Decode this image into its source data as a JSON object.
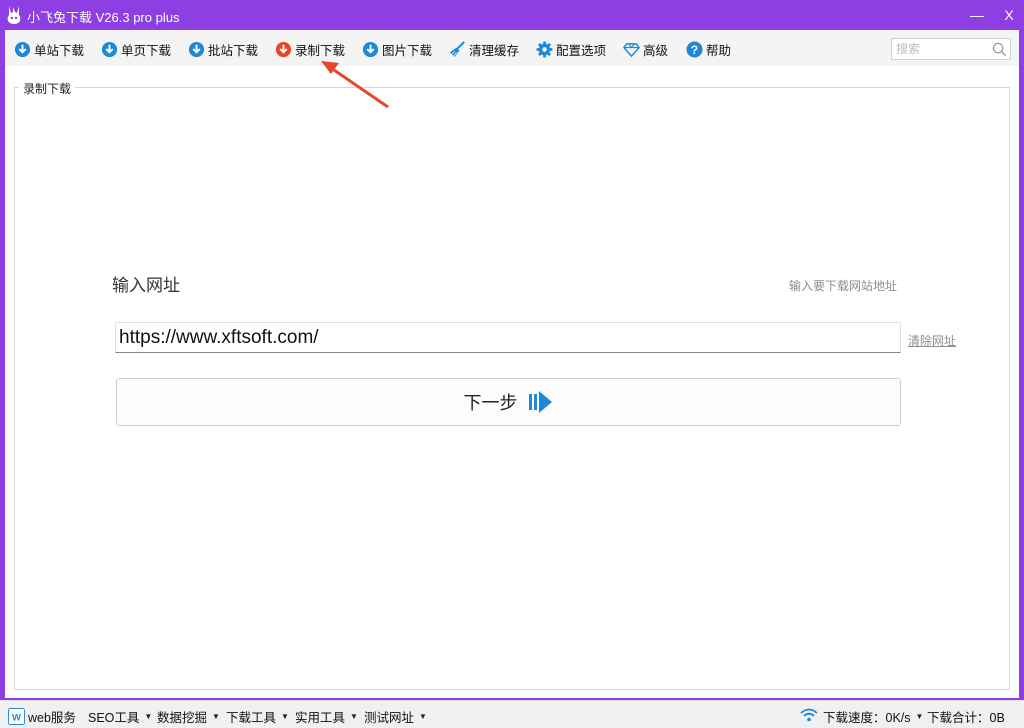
{
  "window": {
    "title": "小飞兔下载 V26.3 pro plus",
    "minimize_glyph": "—",
    "close_glyph": "X"
  },
  "toolbar": {
    "items": [
      {
        "label": "单站下载",
        "icon": "cloud-download-icon",
        "color": "#1e88d8"
      },
      {
        "label": "单页下载",
        "icon": "cloud-download-icon",
        "color": "#1e88d8"
      },
      {
        "label": "批站下载",
        "icon": "cloud-download-icon",
        "color": "#1e88d8"
      },
      {
        "label": "录制下载",
        "icon": "cloud-download-icon",
        "color": "#e8452c"
      },
      {
        "label": "图片下载",
        "icon": "cloud-download-icon",
        "color": "#1e88d8"
      },
      {
        "label": "清理缓存",
        "icon": "broom-icon",
        "color": "#1e88d8"
      },
      {
        "label": "配置选项",
        "icon": "gear-icon",
        "color": "#1e88d8"
      },
      {
        "label": "高级",
        "icon": "diamond-icon",
        "color": "#1e88d8"
      },
      {
        "label": "帮助",
        "icon": "help-icon",
        "color": "#1e88d8"
      }
    ],
    "search_placeholder": "搜索"
  },
  "panel": {
    "legend": "录制下载",
    "url_title": "输入网址",
    "url_hint": "输入要下载网站地址",
    "url_value": "https://www.xftsoft.com/",
    "clear_link": "清除网址",
    "next_label": "下一步"
  },
  "statusbar": {
    "web_service": "web服务",
    "menus": [
      "SEO工具",
      "数据挖掘",
      "下载工具",
      "实用工具",
      "测试网址"
    ],
    "speed_label": "下载速度：0K/s",
    "total_label": "下载合计：0B"
  },
  "colors": {
    "titlebar": "#8e3fe3",
    "accent_blue": "#1e88d8",
    "record_red": "#e8452c",
    "annotation_red": "#e8452c"
  }
}
